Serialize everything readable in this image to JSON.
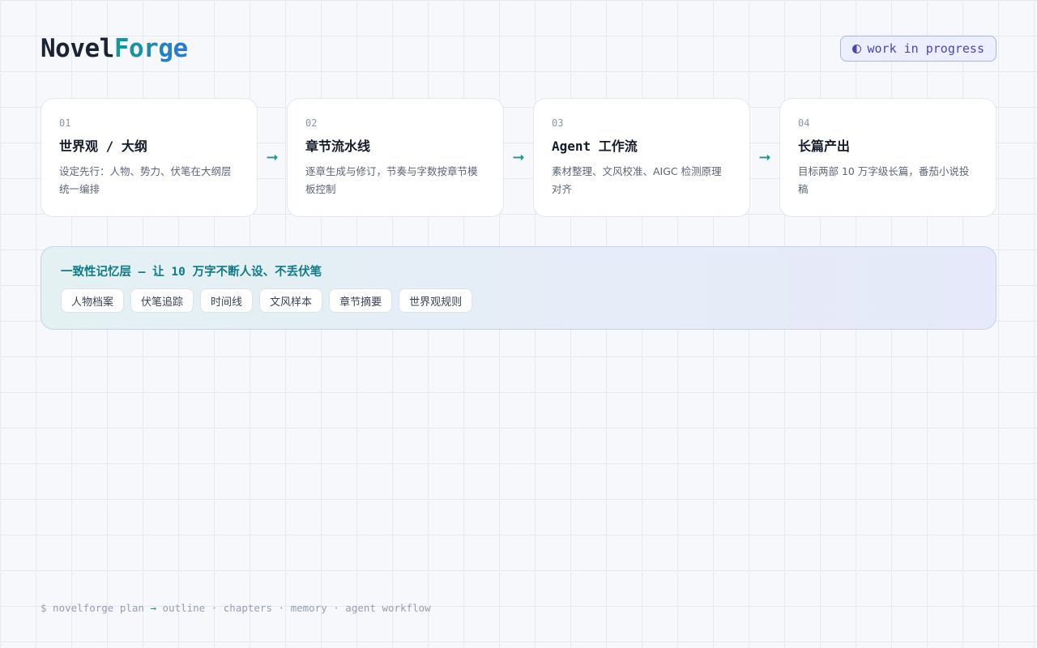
{
  "brand": {
    "name_part_a": "Novel",
    "name_part_b": "Forge"
  },
  "status_badge": {
    "icon": "half-circle-icon",
    "glyph": "◐",
    "label": "work in progress"
  },
  "pipeline": {
    "steps": [
      {
        "num": "01",
        "title": "世界观 / 大纲",
        "desc": "设定先行：人物、势力、伏笔在大纲层统一编排"
      },
      {
        "num": "02",
        "title": "章节流水线",
        "desc": "逐章生成与修订，节奏与字数按章节模板控制"
      },
      {
        "num": "03",
        "title": "Agent 工作流",
        "desc": "素材整理、文风校准、AIGC 检测原理对齐"
      },
      {
        "num": "04",
        "title": "长篇产出",
        "desc": "目标两部 10 万字级长篇，番茄小说投稿"
      }
    ],
    "arrow_glyph": "➞"
  },
  "memory_layer": {
    "title": "一致性记忆层 — 让 10 万字不断人设、不丢伏笔",
    "tags": [
      "人物档案",
      "伏笔追踪",
      "时间线",
      "文风样本",
      "章节摘要",
      "世界观规则"
    ]
  },
  "cli": {
    "prompt": "$ novelforge plan ",
    "arrow": "→",
    "rest": " outline · chapters · memory · agent workflow"
  },
  "colors": {
    "accent_teal": "#0f9c8e",
    "accent_blue": "#2a78d8",
    "badge_indigo": "#4a45b8"
  }
}
